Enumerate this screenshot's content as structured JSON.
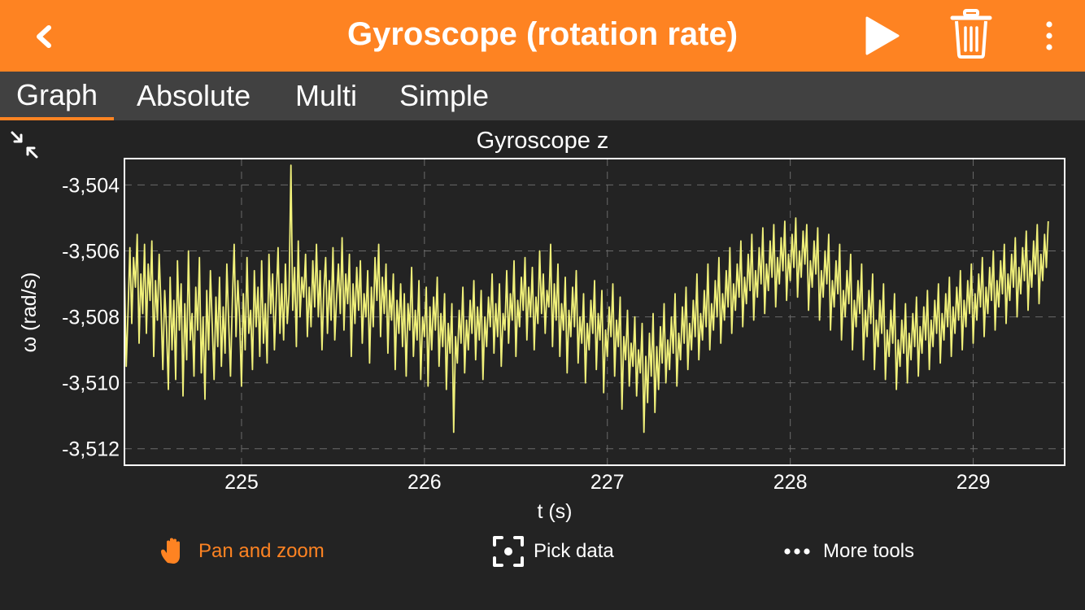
{
  "header": {
    "title": "Gyroscope (rotation rate)",
    "icons": {
      "back": "chevron-left-icon",
      "play": "play-icon",
      "delete": "trash-icon",
      "more": "vertical-ellipsis-icon"
    }
  },
  "tabs": [
    {
      "label": "Graph",
      "active": true
    },
    {
      "label": "Absolute",
      "active": false
    },
    {
      "label": "Multi",
      "active": false
    },
    {
      "label": "Simple",
      "active": false
    }
  ],
  "colors": {
    "accent": "#fe8322",
    "background": "#232323",
    "tabbar": "#414141",
    "series": "#f0f07a"
  },
  "chart_data": {
    "type": "line",
    "title": "Gyroscope z",
    "xlabel": "t (s)",
    "ylabel": "ω (rad/s)",
    "xlim": [
      224.36,
      229.5
    ],
    "ylim": [
      -3.5125,
      -3.5032
    ],
    "xticks": [
      {
        "value": 225,
        "label": "225"
      },
      {
        "value": 226,
        "label": "226"
      },
      {
        "value": 227,
        "label": "227"
      },
      {
        "value": 228,
        "label": "228"
      },
      {
        "value": 229,
        "label": "229"
      }
    ],
    "yticks": [
      {
        "value": -3.504,
        "label": "-3,504"
      },
      {
        "value": -3.506,
        "label": "-3,506"
      },
      {
        "value": -3.508,
        "label": "-3,508"
      },
      {
        "value": -3.51,
        "label": "-3,510"
      },
      {
        "value": -3.512,
        "label": "-3,512"
      }
    ],
    "grid": true,
    "series": [
      {
        "name": "",
        "x_start": 224.36,
        "x_step": 0.01,
        "values": [
          -3.5066,
          -3.5095,
          -3.5078,
          -3.5059,
          -3.5082,
          -3.5062,
          -3.5071,
          -3.5055,
          -3.5088,
          -3.5067,
          -3.5079,
          -3.5058,
          -3.5085,
          -3.5064,
          -3.5075,
          -3.5057,
          -3.5092,
          -3.5069,
          -3.5081,
          -3.5061,
          -3.5077,
          -3.5096,
          -3.5072,
          -3.5083,
          -3.5102,
          -3.5068,
          -3.509,
          -3.5075,
          -3.5099,
          -3.5063,
          -3.5084,
          -3.507,
          -3.5104,
          -3.5076,
          -3.5093,
          -3.506,
          -3.5087,
          -3.5079,
          -3.5098,
          -3.5071,
          -3.5084,
          -3.5062,
          -3.5097,
          -3.508,
          -3.5105,
          -3.5072,
          -3.509,
          -3.5066,
          -3.5083,
          -3.5099,
          -3.5074,
          -3.5089,
          -3.5068,
          -3.5095,
          -3.5077,
          -3.5091,
          -3.5064,
          -3.5082,
          -3.5098,
          -3.5075,
          -3.5058,
          -3.5086,
          -3.5069,
          -3.5081,
          -3.5101,
          -3.5073,
          -3.509,
          -3.5062,
          -3.5085,
          -3.5078,
          -3.5096,
          -3.5066,
          -3.5083,
          -3.5071,
          -3.5092,
          -3.5063,
          -3.5088,
          -3.5076,
          -3.5094,
          -3.5061,
          -3.5079,
          -3.5067,
          -3.509,
          -3.5074,
          -3.5059,
          -3.5085,
          -3.507,
          -3.5087,
          -3.5064,
          -3.5082,
          -3.5073,
          -3.5034,
          -3.5078,
          -3.5065,
          -3.5089,
          -3.5057,
          -3.508,
          -3.5068,
          -3.5074,
          -3.5061,
          -3.5086,
          -3.5071,
          -3.5083,
          -3.5063,
          -3.5077,
          -3.5058,
          -3.508,
          -3.5066,
          -3.509,
          -3.5072,
          -3.5062,
          -3.5085,
          -3.5069,
          -3.5081,
          -3.5059,
          -3.5087,
          -3.5074,
          -3.5064,
          -3.5079,
          -3.5056,
          -3.5084,
          -3.5067,
          -3.5076,
          -3.5061,
          -3.5092,
          -3.507,
          -3.5082,
          -3.5065,
          -3.5078,
          -3.5063,
          -3.5088,
          -3.5073,
          -3.508,
          -3.5066,
          -3.5094,
          -3.5071,
          -3.5083,
          -3.5062,
          -3.5075,
          -3.5058,
          -3.5086,
          -3.5068,
          -3.5079,
          -3.5064,
          -3.5091,
          -3.5072,
          -3.5081,
          -3.5067,
          -3.5096,
          -3.5075,
          -3.5085,
          -3.507,
          -3.5089,
          -3.5073,
          -3.5098,
          -3.5076,
          -3.5084,
          -3.5065,
          -3.5092,
          -3.5078,
          -3.5087,
          -3.5069,
          -3.5099,
          -3.508,
          -3.5086,
          -3.5071,
          -3.5101,
          -3.5077,
          -3.509,
          -3.5074,
          -3.5084,
          -3.5068,
          -3.5095,
          -3.5079,
          -3.5089,
          -3.5073,
          -3.5102,
          -3.5082,
          -3.5091,
          -3.5076,
          -3.5115,
          -3.5086,
          -3.5094,
          -3.5078,
          -3.5088,
          -3.5071,
          -3.5097,
          -3.5081,
          -3.509,
          -3.5075,
          -3.5085,
          -3.5069,
          -3.5093,
          -3.5077,
          -3.5087,
          -3.5072,
          -3.5099,
          -3.508,
          -3.5089,
          -3.5074,
          -3.5083,
          -3.5067,
          -3.5091,
          -3.5076,
          -3.5086,
          -3.507,
          -3.5095,
          -3.5079,
          -3.5084,
          -3.5066,
          -3.5088,
          -3.5073,
          -3.5081,
          -3.5063,
          -3.5092,
          -3.5075,
          -3.5083,
          -3.5068,
          -3.5078,
          -3.5062,
          -3.5087,
          -3.5071,
          -3.508,
          -3.5065,
          -3.509,
          -3.5074,
          -3.5082,
          -3.506,
          -3.5079,
          -3.5067,
          -3.5085,
          -3.5072,
          -3.5077,
          -3.5058,
          -3.5089,
          -3.507,
          -3.5081,
          -3.5064,
          -3.5092,
          -3.5076,
          -3.5084,
          -3.5068,
          -3.5097,
          -3.5078,
          -3.5086,
          -3.5071,
          -3.5083,
          -3.5066,
          -3.5094,
          -3.508,
          -3.5088,
          -3.5073,
          -3.51,
          -3.5082,
          -3.509,
          -3.5075,
          -3.5085,
          -3.5069,
          -3.5096,
          -3.5079,
          -3.5087,
          -3.5072,
          -3.5103,
          -3.5084,
          -3.5092,
          -3.5077,
          -3.5086,
          -3.507,
          -3.5098,
          -3.5081,
          -3.5089,
          -3.5074,
          -3.5108,
          -3.5086,
          -3.5093,
          -3.5078,
          -3.5101,
          -3.5088,
          -3.5095,
          -3.508,
          -3.5104,
          -3.509,
          -3.5097,
          -3.5082,
          -3.5115,
          -3.5092,
          -3.5106,
          -3.5085,
          -3.5098,
          -3.5079,
          -3.5109,
          -3.5089,
          -3.5102,
          -3.5083,
          -3.5094,
          -3.5076,
          -3.51,
          -3.5087,
          -3.5096,
          -3.508,
          -3.5091,
          -3.5073,
          -3.5101,
          -3.5085,
          -3.5093,
          -3.5077,
          -3.5088,
          -3.5071,
          -3.5096,
          -3.5082,
          -3.509,
          -3.5075,
          -3.5086,
          -3.5067,
          -3.5093,
          -3.5079,
          -3.5087,
          -3.5072,
          -3.5083,
          -3.5064,
          -3.509,
          -3.5076,
          -3.5084,
          -3.5069,
          -3.508,
          -3.5062,
          -3.5088,
          -3.5073,
          -3.5081,
          -3.5066,
          -3.5077,
          -3.5059,
          -3.5085,
          -3.507,
          -3.5078,
          -3.5064,
          -3.5074,
          -3.5057,
          -3.5083,
          -3.5068,
          -3.5076,
          -3.5061,
          -3.5072,
          -3.5055,
          -3.5081,
          -3.5066,
          -3.5074,
          -3.5059,
          -3.507,
          -3.5053,
          -3.5079,
          -3.5064,
          -3.5072,
          -3.5057,
          -3.5068,
          -3.5052,
          -3.5077,
          -3.5062,
          -3.507,
          -3.5056,
          -3.5066,
          -3.5051,
          -3.5075,
          -3.5061,
          -3.5069,
          -3.5055,
          -3.5065,
          -3.505,
          -3.5074,
          -3.506,
          -3.5068,
          -3.5054,
          -3.5064,
          -3.5052,
          -3.5078,
          -3.5063,
          -3.5071,
          -3.5057,
          -3.5067,
          -3.5053,
          -3.5081,
          -3.5066,
          -3.5074,
          -3.506,
          -3.507,
          -3.5055,
          -3.5084,
          -3.5069,
          -3.5077,
          -3.5063,
          -3.5073,
          -3.5058,
          -3.5087,
          -3.5072,
          -3.508,
          -3.5066,
          -3.5076,
          -3.5061,
          -3.509,
          -3.5075,
          -3.5083,
          -3.5069,
          -3.5079,
          -3.5064,
          -3.5093,
          -3.5078,
          -3.5086,
          -3.5072,
          -3.5082,
          -3.5067,
          -3.5096,
          -3.5081,
          -3.5089,
          -3.5075,
          -3.5085,
          -3.507,
          -3.5099,
          -3.5084,
          -3.5092,
          -3.5078,
          -3.5088,
          -3.5073,
          -3.5102,
          -3.5087,
          -3.5095,
          -3.5081,
          -3.5091,
          -3.5076,
          -3.51,
          -3.5085,
          -3.5093,
          -3.5079,
          -3.5089,
          -3.5074,
          -3.5098,
          -3.5083,
          -3.5091,
          -3.5077,
          -3.5087,
          -3.5072,
          -3.5096,
          -3.5081,
          -3.5089,
          -3.5075,
          -3.5085,
          -3.507,
          -3.5094,
          -3.5079,
          -3.5087,
          -3.5073,
          -3.5083,
          -3.5068,
          -3.5092,
          -3.5077,
          -3.5085,
          -3.5071,
          -3.5081,
          -3.5066,
          -3.509,
          -3.5075,
          -3.5083,
          -3.5069,
          -3.5079,
          -3.5064,
          -3.5088,
          -3.5073,
          -3.5081,
          -3.5067,
          -3.5077,
          -3.5062,
          -3.5086,
          -3.5071,
          -3.5079,
          -3.5065,
          -3.5075,
          -3.506,
          -3.5084,
          -3.5069,
          -3.5077,
          -3.5063,
          -3.5073,
          -3.5058,
          -3.5082,
          -3.5067,
          -3.5075,
          -3.5061,
          -3.5071,
          -3.5056,
          -3.508,
          -3.5065,
          -3.5073,
          -3.5059,
          -3.5069,
          -3.5054,
          -3.5078,
          -3.5063,
          -3.5071,
          -3.5057,
          -3.5067,
          -3.5052,
          -3.5076,
          -3.5061,
          -3.5069,
          -3.5055,
          -3.5065,
          -3.5051
        ]
      }
    ]
  },
  "toolbar": {
    "pan_zoom": {
      "label": "Pan and zoom",
      "icon": "hand-icon"
    },
    "pick_data": {
      "label": "Pick data",
      "icon": "target-icon"
    },
    "more_tools": {
      "label": "More tools",
      "icon": "horizontal-ellipsis-icon"
    }
  }
}
